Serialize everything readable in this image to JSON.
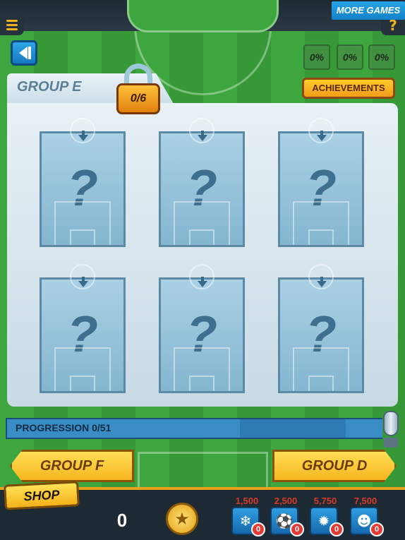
{
  "header": {
    "more_games_label": "MORE GAMES",
    "help_label": "?"
  },
  "completion_badges": [
    "0%",
    "0%",
    "0%"
  ],
  "achievements_label": "ACHIEVEMENTS",
  "group": {
    "title": "GROUP E",
    "lock_progress": "0/6"
  },
  "cards": [
    {
      "label": "?"
    },
    {
      "label": "?"
    },
    {
      "label": "?"
    },
    {
      "label": "?"
    },
    {
      "label": "?"
    },
    {
      "label": "?"
    }
  ],
  "progression": {
    "label": "PROGRESSION  0/51"
  },
  "navigation": {
    "prev_label": "GROUP F",
    "next_label": "GROUP D"
  },
  "shop": {
    "label": "SHOP",
    "coins": "0",
    "powerups": [
      {
        "name": "ice-powerup",
        "price": "1,500",
        "count": "0"
      },
      {
        "name": "ball-powerup",
        "price": "2,500",
        "count": "0"
      },
      {
        "name": "fire-powerup",
        "price": "5,750",
        "count": "0"
      },
      {
        "name": "player-powerup",
        "price": "7,500",
        "count": "0"
      }
    ]
  },
  "colors": {
    "pitch": "#3ea63e",
    "accent": "#f3b21c",
    "card": "#aad0e4",
    "progress": "#2a6c9c"
  }
}
